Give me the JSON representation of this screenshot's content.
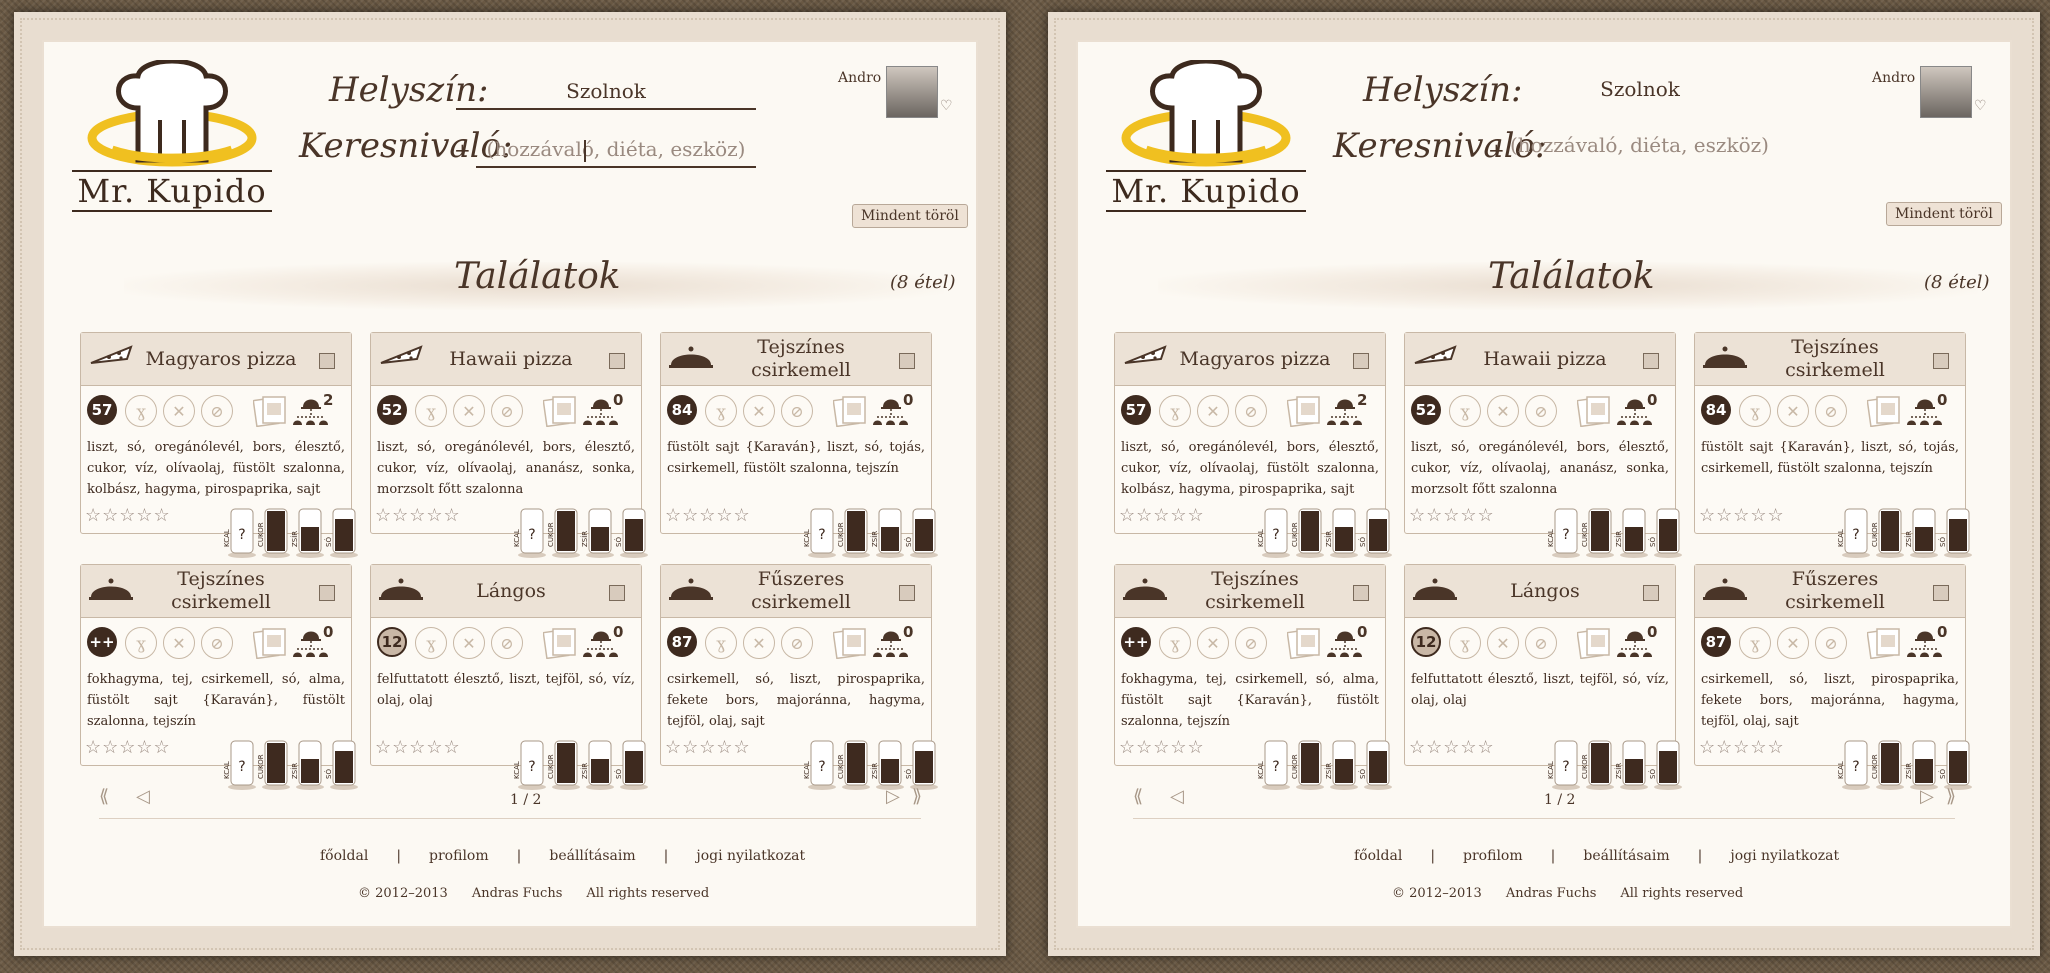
{
  "site": {
    "logo_text": "Mr. Kupido"
  },
  "search": {
    "location_label": "Helyszín:",
    "location_value": "Szolnok",
    "query_label": "Keresnivaló:",
    "query_plus": "+",
    "query_placeholder": "(hozzávaló, diéta, eszköz)"
  },
  "user": {
    "name": "Andro",
    "heart": "♡"
  },
  "clear_all": "Mindent töröl",
  "results": {
    "title": "Találatok",
    "count": "(8 étel)"
  },
  "cards": [
    {
      "title": "Magyaros pizza",
      "score": "57",
      "cloche_count": "2",
      "ingredients": "liszt, só, oregánólevél, bors, élesztő, cukor, víz, olívaolaj, füstölt szalonna, kolbász, hagyma, pirospaprika, sajt",
      "icon": "pizza-icon"
    },
    {
      "title": "Hawaii pizza",
      "score": "52",
      "cloche_count": "0",
      "ingredients": "liszt, só, oregánólevél, bors, élesztő, cukor, víz, olívaolaj, ananász, sonka, morzsolt főtt szalonna",
      "icon": "pizza-icon"
    },
    {
      "title": "Tejszínes csirkemell",
      "score": "84",
      "cloche_count": "0",
      "ingredients": "füstölt sajt {Karaván}, liszt, só, tojás, csirkemell, füstölt szalonna, tejszín",
      "icon": "cloche-icon"
    },
    {
      "title": "Tejszínes csirkemell",
      "score": "++",
      "cloche_count": "0",
      "ingredients": "fokhagyma, tej, csirkemell, só, alma, füstölt sajt {Karaván}, füstölt szalonna, tejszín",
      "icon": "cloche-icon"
    },
    {
      "title": "Lángos",
      "score": "12",
      "cloche_count": "0",
      "ingredients": "felfuttatott élesztő, liszt, tejföl, só, víz, olaj, olaj",
      "icon": "cloche-icon",
      "light": true
    },
    {
      "title": "Fűszeres csirkemell",
      "score": "87",
      "cloche_count": "0",
      "ingredients": "csirkemell, só, liszt, pirospaprika, fekete bors, majoránna, hagyma, tejföl, olaj, sajt",
      "icon": "cloche-icon"
    }
  ],
  "rating": {
    "stars": "☆☆☆☆☆"
  },
  "nutrition": {
    "labels": [
      "KCAL",
      "CUKOR",
      "ZSÍR",
      "SÓ"
    ],
    "kcal_mark": "?"
  },
  "pager": {
    "text": "1 / 2",
    "first": "⟪",
    "prev": "◁",
    "next": "▷",
    "last": "⟫"
  },
  "footer": {
    "links": [
      "főoldal",
      "|",
      "profilom",
      "|",
      "beállításaim",
      "|",
      "jogi nyilatkozat"
    ],
    "copyright": "© 2012–2013",
    "author": "Andras Fuchs",
    "rights": "All rights reserved"
  }
}
